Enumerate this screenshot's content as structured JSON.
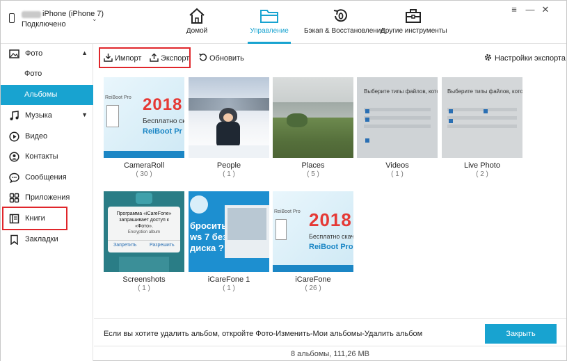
{
  "header": {
    "device_name": "iPhone (iPhone 7)",
    "device_status": "Подключено",
    "tabs": [
      {
        "label": "Домой",
        "icon": "home-icon"
      },
      {
        "label": "Управление",
        "icon": "folder-icon"
      },
      {
        "label": "Бэкап & Восстановление",
        "icon": "backup-restore-icon"
      },
      {
        "label": "Другие инструменты",
        "icon": "toolbox-icon"
      }
    ],
    "active_tab": "Управление",
    "window_controls": [
      "≡",
      "—",
      "✕"
    ]
  },
  "sidebar": {
    "items": [
      {
        "label": "Фото",
        "icon": "photo-icon",
        "expander": "▲"
      },
      {
        "label": "Фото"
      },
      {
        "label": "Альбомы"
      },
      {
        "label": "Музыка",
        "icon": "music-icon",
        "expander": "▼"
      },
      {
        "label": "Видео",
        "icon": "video-icon"
      },
      {
        "label": "Контакты",
        "icon": "contacts-icon"
      },
      {
        "label": "Сообщения",
        "icon": "messages-icon"
      },
      {
        "label": "Приложения",
        "icon": "apps-icon"
      },
      {
        "label": "Книги",
        "icon": "books-icon"
      },
      {
        "label": "Закладки",
        "icon": "bookmark-icon"
      }
    ],
    "active_item": "Альбомы"
  },
  "toolbar": {
    "import_label": "Импорт",
    "export_label": "Экспорт",
    "refresh_label": "Обновить",
    "export_settings_label": "Настройки экспорта"
  },
  "albums": [
    {
      "title": "CameraRoll",
      "count": "( 30 )",
      "thumb_title": "2018",
      "thumb_sub": "Бесплатно ск",
      "thumb_sub2": "ReiBoot Pr",
      "thumb_brand": "ReiBoot Pro"
    },
    {
      "title": "People",
      "count": "( 1 )"
    },
    {
      "title": "Places",
      "count": "( 5 )"
    },
    {
      "title": "Videos",
      "count": "( 1 )",
      "thumb_text": "Выберите типы файлов, котор"
    },
    {
      "title": "Live Photo",
      "count": "( 2 )",
      "thumb_text": "Выберите типы файлов, котор"
    },
    {
      "title": "Screenshots",
      "count": "( 1 )",
      "thumb_text1": "Программа «iCareFone» запрашивает доступ к «Фото».",
      "thumb_text2": "Encryption album",
      "thumb_btn1": "Запретить",
      "thumb_btn2": "Разрешить"
    },
    {
      "title": "iCareFone 1",
      "count": "( 1 )",
      "thumb_text1": "бросить",
      "thumb_text2": "ws 7 без",
      "thumb_text3": "диска ?"
    },
    {
      "title": "iCareFone",
      "count": "( 26 )",
      "thumb_title": "2018",
      "thumb_sub": "Бесплатно скача",
      "thumb_sub2": "ReiBoot Pro",
      "thumb_brand": "ReiBoot Pro"
    }
  ],
  "info": {
    "message": "Если вы хотите удалить альбом, откройте Фото-Изменить-Мои альбомы-Удалить альбом",
    "close_label": "Закрыть"
  },
  "status": {
    "summary": "8 альбомы, 111,26 MB"
  },
  "colors": {
    "accent": "#18a3d0",
    "highlight_box": "#e0262b",
    "banner_red": "#e53935",
    "banner_teal": "#1b86c5"
  }
}
